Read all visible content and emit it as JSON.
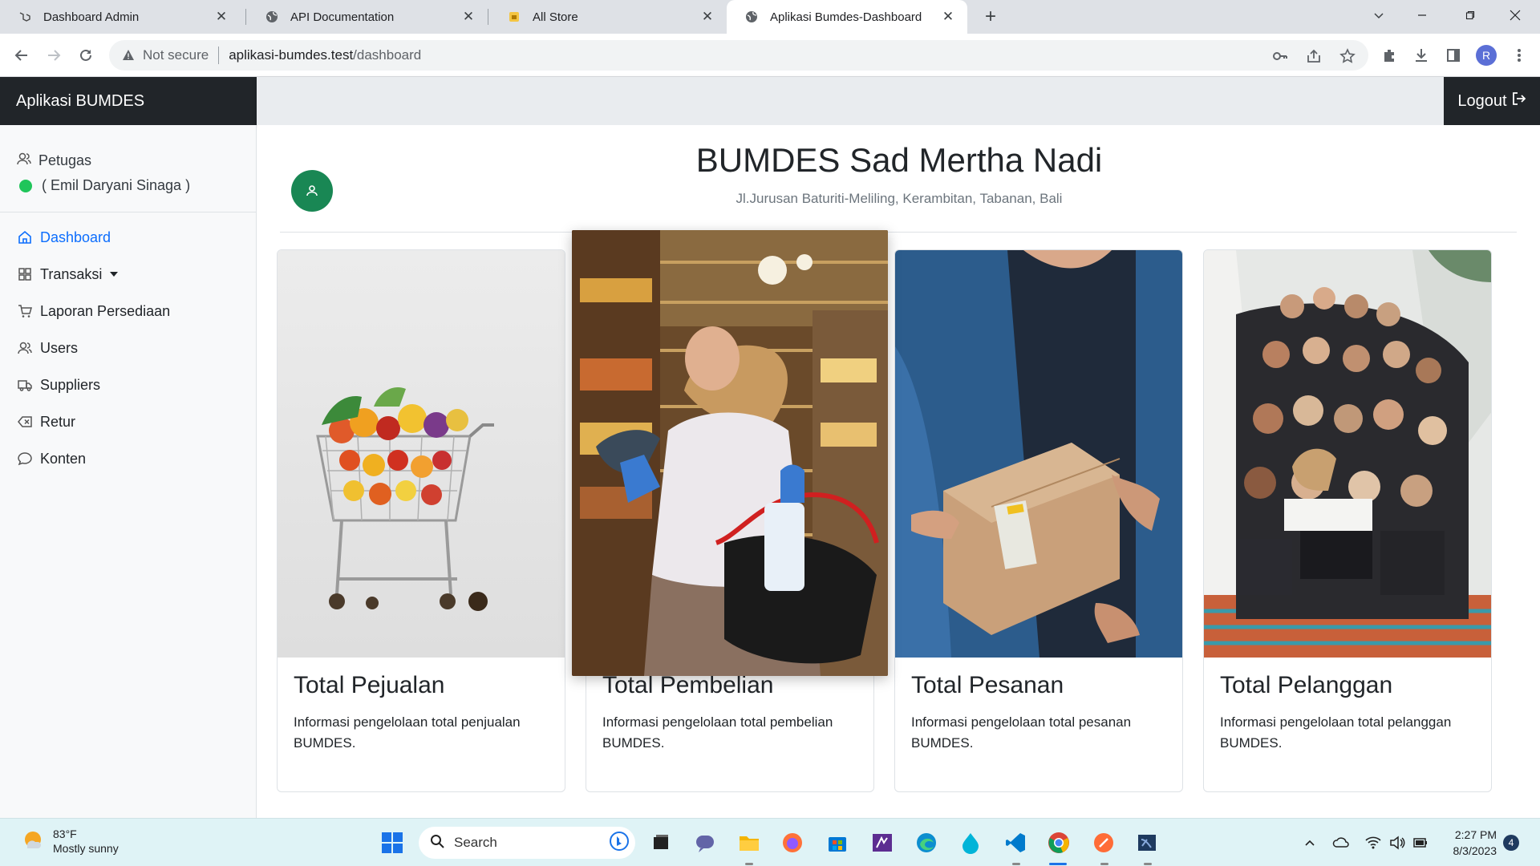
{
  "browser": {
    "tabs": [
      {
        "title": "Dashboard Admin",
        "icon": "laravel-icon",
        "active": false
      },
      {
        "title": "API Documentation",
        "icon": "globe-icon",
        "active": false
      },
      {
        "title": "All Store",
        "icon": "store-icon",
        "active": false
      },
      {
        "title": "Aplikasi Bumdes-Dashboard",
        "icon": "globe-icon",
        "active": true
      }
    ],
    "security_label": "Not secure",
    "url_host": "aplikasi-bumdes.test",
    "url_path": "/dashboard",
    "profile_initial": "R"
  },
  "app": {
    "brand": "Aplikasi BUMDES",
    "logout_label": "Logout"
  },
  "sidebar": {
    "role": "Petugas",
    "user_name": "( Emil Daryani Sinaga )",
    "items": [
      {
        "label": "Dashboard",
        "icon": "home-icon",
        "active": true
      },
      {
        "label": "Transaksi",
        "icon": "grid-icon",
        "dropdown": true
      },
      {
        "label": "Laporan Persediaan",
        "icon": "cart-icon"
      },
      {
        "label": "Users",
        "icon": "users-icon"
      },
      {
        "label": "Suppliers",
        "icon": "truck-icon"
      },
      {
        "label": "Retur",
        "icon": "backspace-icon"
      },
      {
        "label": "Konten",
        "icon": "chat-icon"
      }
    ]
  },
  "main": {
    "title": "BUMDES Sad Mertha Nadi",
    "address": "Jl.Jurusan Baturiti-Meliling, Kerambitan, Tabanan, Bali",
    "cards": [
      {
        "title": "Total Pejualan",
        "text": "Informasi pengelolaan total penjualan BUMDES."
      },
      {
        "title": "Total Pembelian",
        "text": "Informasi pengelolaan total pembelian BUMDES."
      },
      {
        "title": "Total Pesanan",
        "text": "Informasi pengelolaan total pesanan BUMDES."
      },
      {
        "title": "Total Pelanggan",
        "text": "Informasi pengelolaan total pelanggan BUMDES."
      }
    ]
  },
  "taskbar": {
    "temperature": "83°F",
    "weather": "Mostly sunny",
    "search_placeholder": "Search",
    "time": "2:27 PM",
    "date": "8/3/2023",
    "notification_count": "4"
  },
  "colors": {
    "accent": "#0d6efd",
    "brand_bg": "#212529",
    "avatar_bg": "#198754",
    "status_online": "#20c55a"
  }
}
